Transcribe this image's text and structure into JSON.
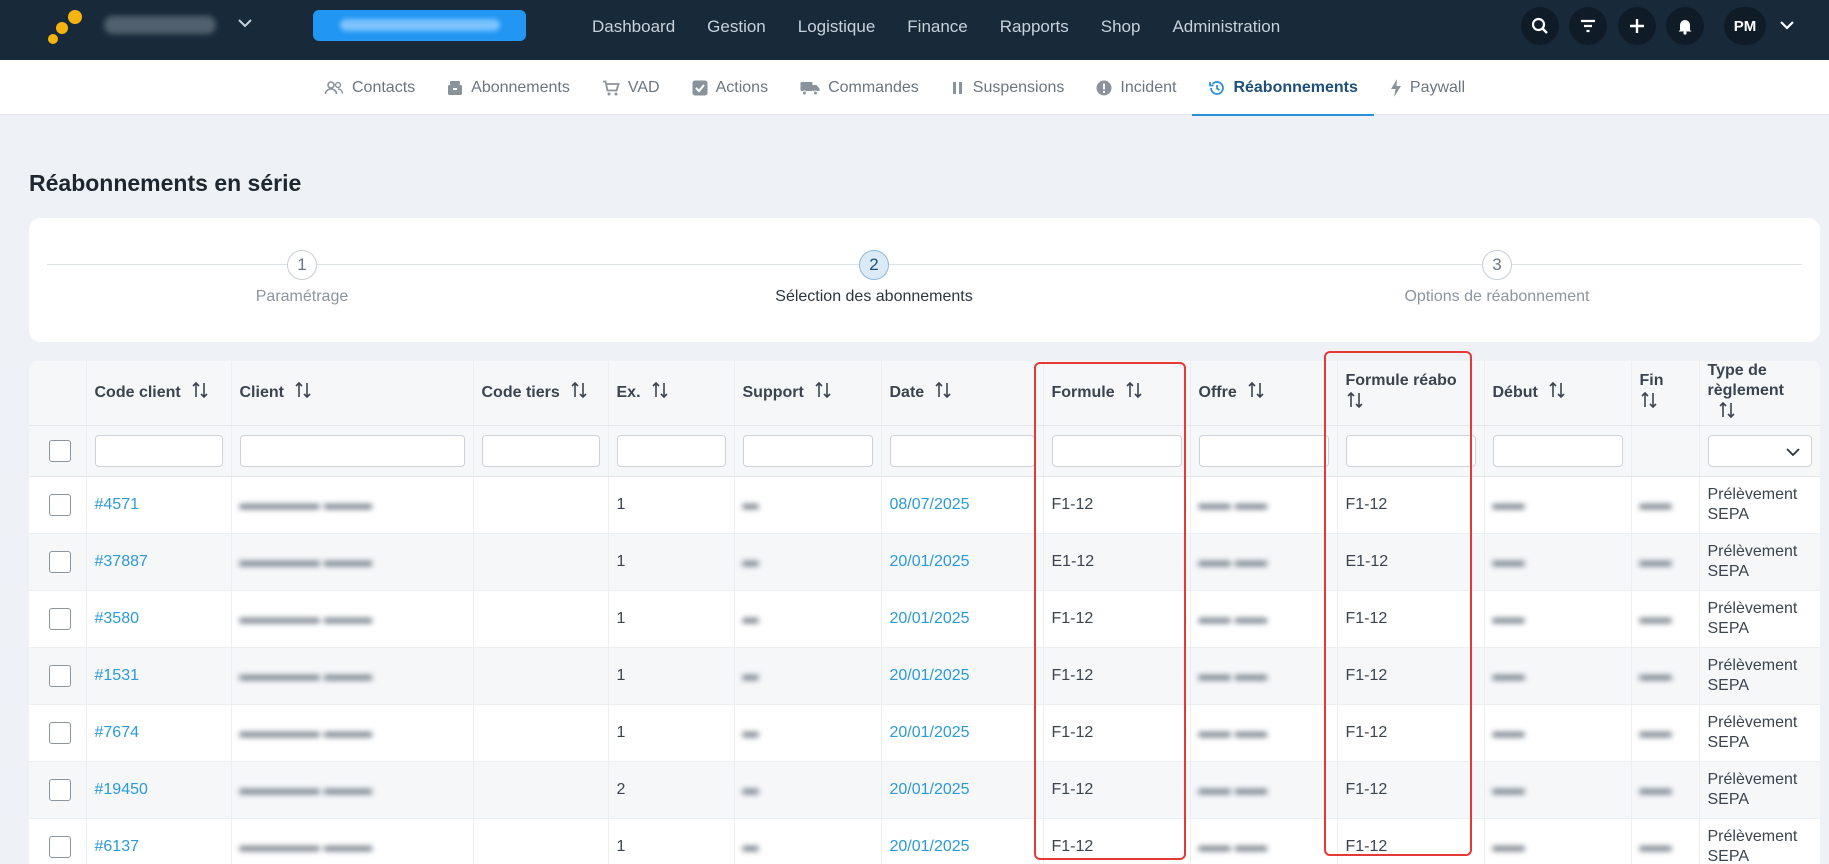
{
  "nav": {
    "items": [
      "Dashboard",
      "Gestion",
      "Logistique",
      "Finance",
      "Rapports",
      "Shop",
      "Administration"
    ],
    "avatar": "PM"
  },
  "subnav": {
    "items": [
      {
        "label": "Contacts",
        "icon": "users-icon"
      },
      {
        "label": "Abonnements",
        "icon": "box-icon"
      },
      {
        "label": "VAD",
        "icon": "cart-icon"
      },
      {
        "label": "Actions",
        "icon": "checkbox-icon"
      },
      {
        "label": "Commandes",
        "icon": "truck-icon"
      },
      {
        "label": "Suspensions",
        "icon": "pause-icon"
      },
      {
        "label": "Incident",
        "icon": "alert-icon"
      },
      {
        "label": "Réabonnements",
        "icon": "history-icon",
        "active": true
      },
      {
        "label": "Paywall",
        "icon": "bolt-icon"
      }
    ]
  },
  "page_title": "Réabonnements en série",
  "stepper": {
    "steps": [
      {
        "num": "1",
        "label": "Paramétrage"
      },
      {
        "num": "2",
        "label": "Sélection des abonnements",
        "active": true
      },
      {
        "num": "3",
        "label": "Options de réabonnement"
      }
    ]
  },
  "table": {
    "columns": [
      "Code client",
      "Client",
      "Code tiers",
      "Ex.",
      "Support",
      "Date",
      "Formule",
      "Offre",
      "Formule réabo",
      "Début",
      "Fin",
      "Type de règlement"
    ],
    "rows": [
      {
        "code": "#4571",
        "ex": "1",
        "date": "08/07/2025",
        "formule": "F1-12",
        "formule_reabo": "F1-12",
        "reglement": "Prélèvement SEPA"
      },
      {
        "code": "#37887",
        "ex": "1",
        "date": "20/01/2025",
        "formule": "E1-12",
        "formule_reabo": "E1-12",
        "reglement": "Prélèvement SEPA"
      },
      {
        "code": "#3580",
        "ex": "1",
        "date": "20/01/2025",
        "formule": "F1-12",
        "formule_reabo": "F1-12",
        "reglement": "Prélèvement SEPA"
      },
      {
        "code": "#1531",
        "ex": "1",
        "date": "20/01/2025",
        "formule": "F1-12",
        "formule_reabo": "F1-12",
        "reglement": "Prélèvement SEPA"
      },
      {
        "code": "#7674",
        "ex": "1",
        "date": "20/01/2025",
        "formule": "F1-12",
        "formule_reabo": "F1-12",
        "reglement": "Prélèvement SEPA"
      },
      {
        "code": "#19450",
        "ex": "2",
        "date": "20/01/2025",
        "formule": "F1-12",
        "formule_reabo": "F1-12",
        "reglement": "Prélèvement SEPA"
      },
      {
        "code": "#6137",
        "ex": "1",
        "date": "20/01/2025",
        "formule": "F1-12",
        "formule_reabo": "F1-12",
        "reglement": "Prélèvement SEPA"
      }
    ]
  },
  "colors": {
    "navbar": "#182a3a",
    "accent": "#2b9ad6",
    "cta": "#2196f3",
    "highlight": "#e53935"
  }
}
